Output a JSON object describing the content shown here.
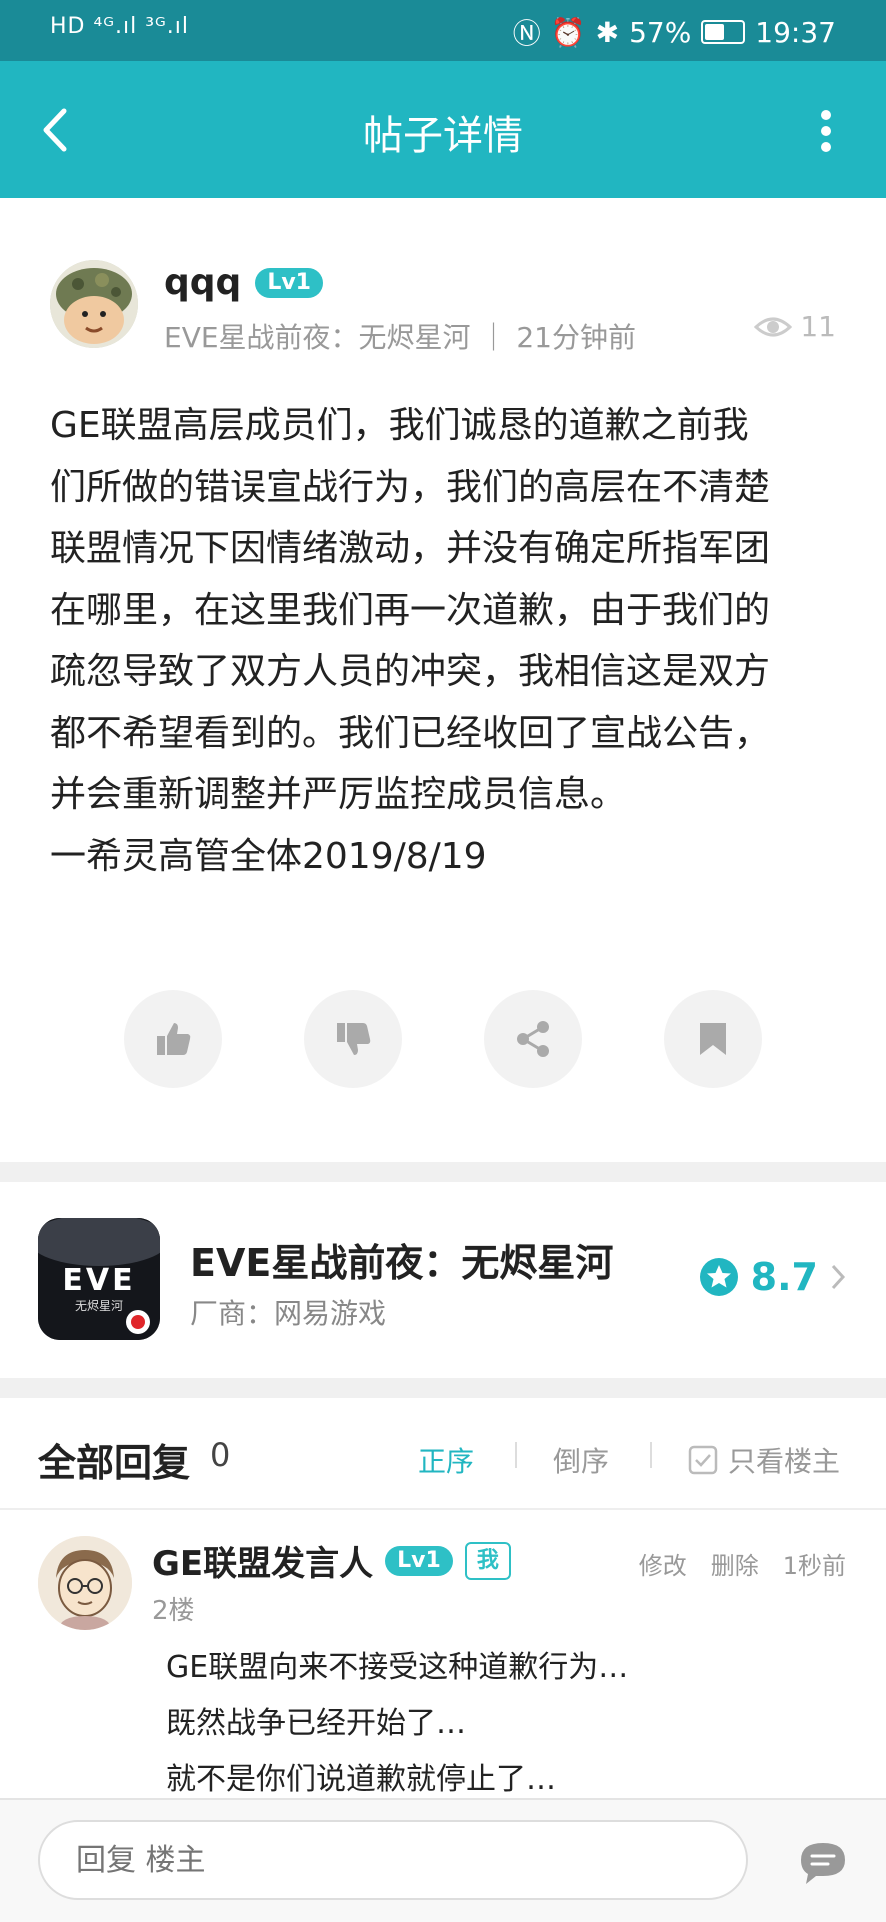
{
  "status_bar": {
    "left": "HD ⁴ᴳ.ıl ³ᴳ.ıl",
    "battery_pct_text": "57%",
    "battery_level": 0.57,
    "time": "19:37"
  },
  "nav": {
    "title": "帖子详情"
  },
  "post": {
    "author": "qqq",
    "level": "Lv1",
    "meta": "EVE星战前夜：无烬星河 ｜ 21分钟前",
    "views": "11",
    "content": [
      "GE联盟高层成员们，我们诚恳的道歉之前我",
      "们所做的错误宣战行为，我们的高层在不清楚",
      "联盟情况下因情绪激动，并没有确定所指军团",
      "在哪里，在这里我们再一次道歉，由于我们的",
      "疏忽导致了双方人员的冲突，我相信这是双方",
      "都不希望看到的。我们已经收回了宣战公告，",
      "并会重新调整并严厉监控成员信息。",
      "一希灵高管全体2019/8/19"
    ]
  },
  "game": {
    "name": "EVE星战前夜：无烬星河",
    "vendor": "厂商：网易游戏",
    "rating": "8.7",
    "icon_text": "EVE",
    "icon_subtext": "无烬星河"
  },
  "replies": {
    "title": "全部回复",
    "count": "0",
    "sort_asc": "正序",
    "sort_desc": "倒序",
    "only_op": "只看楼主"
  },
  "reply": {
    "author": "GE联盟发言人",
    "level": "Lv1",
    "me_tag": "我",
    "edit": "修改",
    "delete": "删除",
    "time": "1秒前",
    "floor": "2楼",
    "lines": [
      "GE联盟向来不接受这种道歉行为…",
      "既然战争已经开始了…",
      "就不是你们说道歉就停止了…"
    ]
  },
  "bottom": {
    "placeholder": "回复 楼主"
  },
  "colors": {
    "accent": "#21b6c1",
    "status_bar": "#1a8b97"
  }
}
